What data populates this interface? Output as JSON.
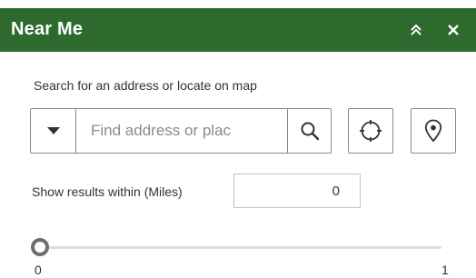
{
  "header": {
    "title": "Near Me",
    "background_color": "#2e6a2e",
    "collapse_icon": "double-chevron-up-icon",
    "close_icon": "close-icon"
  },
  "search": {
    "hint": "Search for an address or locate on map",
    "placeholder": "Find address or plac",
    "value": "",
    "dropdown_icon": "caret-down-icon",
    "search_icon": "search-icon",
    "locate_icon": "locate-crosshair-icon",
    "pin_icon": "map-pin-icon"
  },
  "radius": {
    "label": "Show results within (Miles)",
    "value": "0"
  },
  "slider": {
    "value": 0,
    "min_label": "0",
    "max_label": "1"
  }
}
